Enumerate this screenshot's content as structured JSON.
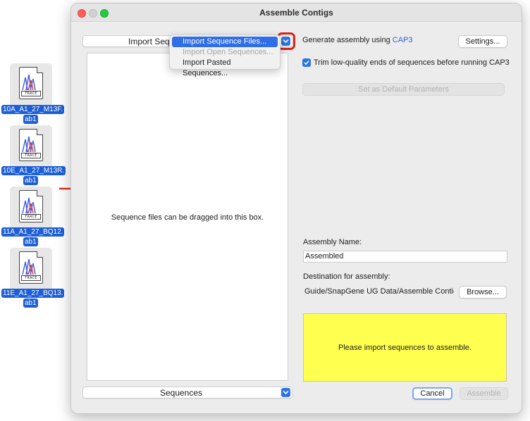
{
  "desktop": {
    "files": [
      {
        "name_line1": "10A_A1_27_M13F.",
        "name_line2": "ab1",
        "tag": "TRACE"
      },
      {
        "name_line1": "10E_A1_27_M13R.",
        "name_line2": "ab1",
        "tag": "TRACE"
      },
      {
        "name_line1": "11A_A1_27_BQ12.",
        "name_line2": "ab1",
        "tag": "TRACE"
      },
      {
        "name_line1": "11E_A1_27_BQ13.",
        "name_line2": "ab1",
        "tag": "TRACE"
      }
    ]
  },
  "window": {
    "title": "Assemble Contigs"
  },
  "left_panel": {
    "import_popup_label": "Import Sequ",
    "drop_hint": "Sequence files can be dragged into this box.",
    "sequences_popup_label": "Sequences"
  },
  "import_menu": {
    "items": [
      {
        "label": "Import Sequence Files...",
        "state": "highlighted"
      },
      {
        "label": "Import Open Sequences...",
        "state": "disabled"
      },
      {
        "label": "Import Pasted Sequences...",
        "state": "enabled"
      }
    ]
  },
  "right_panel": {
    "generate_prefix": "Generate assembly using",
    "generate_link": "CAP3",
    "settings_button": "Settings...",
    "trim_label": "Trim low-quality ends of sequences before running CAP3",
    "trim_checked": true,
    "set_default_button": "Set as Default Parameters",
    "assembly_name_label": "Assembly Name:",
    "assembly_name_value": "Assembled",
    "destination_label": "Destination for assembly:",
    "destination_value": "Guide/SnapGene UG Data/Assemble Contigs/",
    "browse_button": "Browse...",
    "status_message": "Please import sequences to assemble.",
    "cancel_button": "Cancel",
    "assemble_button": "Assemble"
  },
  "colors": {
    "accent": "#2d73e6",
    "highlight_ring": "#d8251a",
    "status_box": "#ffff50",
    "file_label_bg": "#1c5fd8"
  }
}
